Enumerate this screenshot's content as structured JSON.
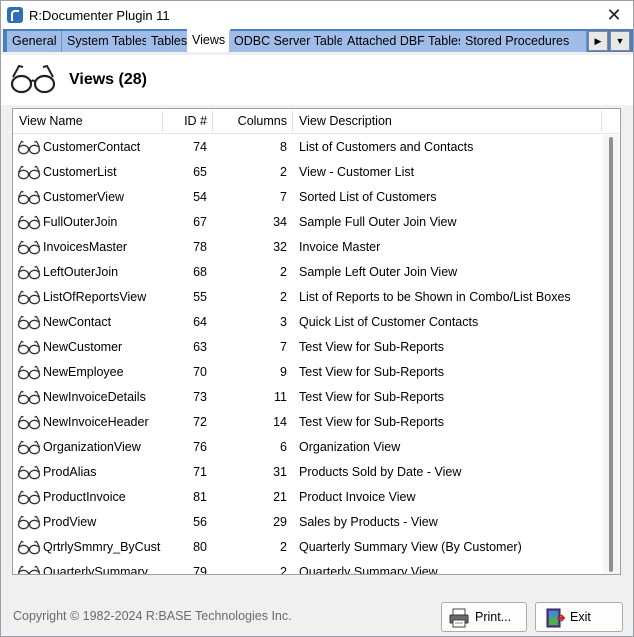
{
  "window": {
    "title": "R:Documenter Plugin 11"
  },
  "tabs": [
    {
      "label": "General",
      "active": false
    },
    {
      "label": "System Tables",
      "active": false
    },
    {
      "label": "Tables",
      "active": false
    },
    {
      "label": "Views",
      "active": true
    },
    {
      "label": "ODBC Server Tables",
      "active": false
    },
    {
      "label": "Attached DBF Tables",
      "active": false
    },
    {
      "label": "Stored Procedures",
      "active": false
    }
  ],
  "header": {
    "title": "Views (28)"
  },
  "columns": {
    "name": "View Name",
    "id": "ID #",
    "cols": "Columns",
    "desc": "View Description"
  },
  "rows": [
    {
      "name": "CustomerContact",
      "id": "74",
      "cols": "8",
      "desc": "List of Customers and Contacts"
    },
    {
      "name": "CustomerList",
      "id": "65",
      "cols": "2",
      "desc": "View - Customer List"
    },
    {
      "name": "CustomerView",
      "id": "54",
      "cols": "7",
      "desc": "Sorted List of Customers"
    },
    {
      "name": "FullOuterJoin",
      "id": "67",
      "cols": "34",
      "desc": "Sample Full Outer Join View"
    },
    {
      "name": "InvoicesMaster",
      "id": "78",
      "cols": "32",
      "desc": "Invoice Master"
    },
    {
      "name": "LeftOuterJoin",
      "id": "68",
      "cols": "2",
      "desc": "Sample Left Outer Join View"
    },
    {
      "name": "ListOfReportsView",
      "id": "55",
      "cols": "2",
      "desc": "List of Reports to be Shown in Combo/List Boxes"
    },
    {
      "name": "NewContact",
      "id": "64",
      "cols": "3",
      "desc": "Quick List of Customer Contacts"
    },
    {
      "name": "NewCustomer",
      "id": "63",
      "cols": "7",
      "desc": "Test View for Sub-Reports"
    },
    {
      "name": "NewEmployee",
      "id": "70",
      "cols": "9",
      "desc": "Test View for Sub-Reports"
    },
    {
      "name": "NewInvoiceDetails",
      "id": "73",
      "cols": "11",
      "desc": "Test View for Sub-Reports"
    },
    {
      "name": "NewInvoiceHeader",
      "id": "72",
      "cols": "14",
      "desc": "Test View for Sub-Reports"
    },
    {
      "name": "OrganizationView",
      "id": "76",
      "cols": "6",
      "desc": "Organization View"
    },
    {
      "name": "ProdAlias",
      "id": "71",
      "cols": "31",
      "desc": "Products Sold by Date - View"
    },
    {
      "name": "ProductInvoice",
      "id": "81",
      "cols": "21",
      "desc": "Product Invoice View"
    },
    {
      "name": "ProdView",
      "id": "56",
      "cols": "29",
      "desc": "Sales by Products - View"
    },
    {
      "name": "QrtrlySmmry_ByCust",
      "id": "80",
      "cols": "2",
      "desc": "Quarterly Summary View (By Customer)"
    },
    {
      "name": "QuarterlySummary",
      "id": "79",
      "cols": "2",
      "desc": "Quarterly Summary View"
    }
  ],
  "footer": {
    "copyright": "Copyright © 1982-2024 R:BASE Technologies Inc.",
    "print_label": "Print...",
    "exit_label": "Exit"
  },
  "icons": {
    "app": "rbase-app-icon",
    "view": "glasses-icon",
    "print": "printer-icon",
    "exit": "exit-door-icon",
    "close": "close-icon"
  },
  "colors": {
    "tab_strip": "#4a7ebf",
    "tab_inactive": "#9fbde8",
    "tab_active": "#ffffff"
  }
}
